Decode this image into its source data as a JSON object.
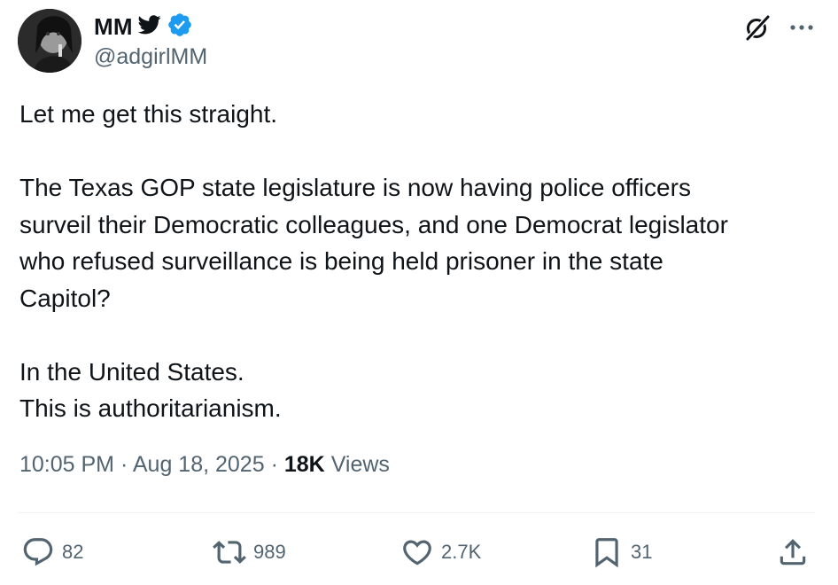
{
  "author": {
    "display_name": "MM",
    "handle": "@adgirlMM",
    "verified": true,
    "verified_color": "#1d9bf0"
  },
  "tweet": {
    "lines": [
      "Let me get this straight.",
      "",
      "The Texas GOP state legislature is now having police officers",
      "surveil their Democratic colleagues, and one Democrat legislator",
      "who refused surveillance is being held prisoner in the state",
      "Capitol?",
      "",
      "In the United States.",
      "This is authoritarianism."
    ],
    "time": "10:05 PM",
    "date": "Aug 18, 2025",
    "separator": "·",
    "views_count": "18K",
    "views_label": "Views"
  },
  "actions": {
    "replies": "82",
    "reposts": "989",
    "likes": "2.7K",
    "bookmarks": "31"
  },
  "icons": {
    "bird": "bird-icon",
    "verified": "verified-badge-icon",
    "grok": "grok-icon",
    "more": "more-icon",
    "reply": "reply-icon",
    "repost": "repost-icon",
    "like": "heart-icon",
    "bookmark": "bookmark-icon",
    "share": "share-icon"
  },
  "colors": {
    "text": "#0f1419",
    "muted": "#536471",
    "divider": "#eff3f4"
  }
}
